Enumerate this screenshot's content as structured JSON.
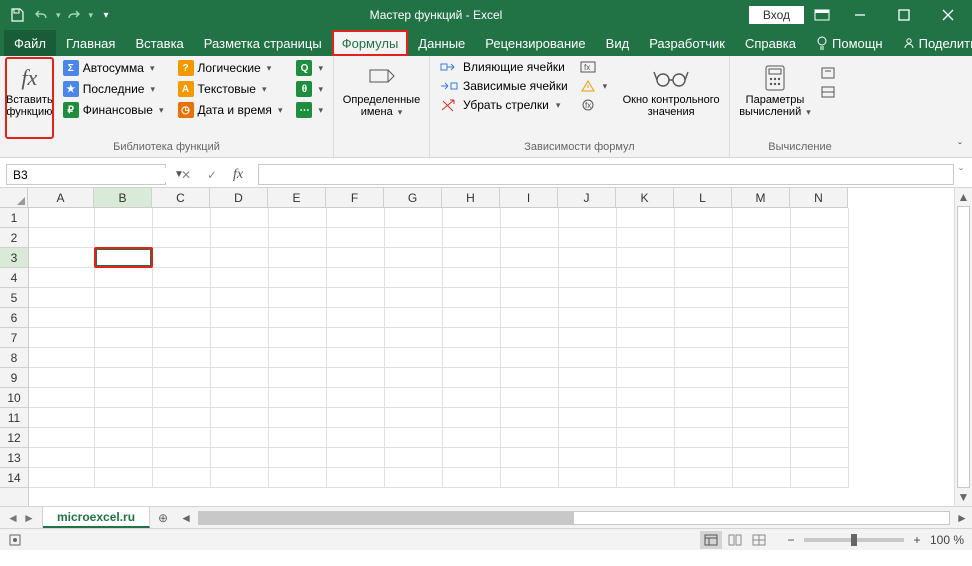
{
  "title": "Мастер функций  -  Excel",
  "signin": "Вход",
  "tabs": {
    "file": "Файл",
    "home": "Главная",
    "insert": "Вставка",
    "layout": "Разметка страницы",
    "formulas": "Формулы",
    "data": "Данные",
    "review": "Рецензирование",
    "view": "Вид",
    "developer": "Разработчик",
    "help": "Справка",
    "tellme": "Помощн",
    "share": "Поделиться"
  },
  "ribbon": {
    "insert_fn_l1": "Вставить",
    "insert_fn_l2": "функцию",
    "autosum": "Автосумма",
    "recent": "Последние",
    "financial": "Финансовые",
    "logical": "Логические",
    "text": "Текстовые",
    "datetime": "Дата и время",
    "group_library": "Библиотека функций",
    "defined_l1": "Определенные",
    "defined_l2": "имена",
    "trace_precedents": "Влияющие ячейки",
    "trace_dependents": "Зависимые ячейки",
    "remove_arrows": "Убрать стрелки",
    "watch_l1": "Окно контрольного",
    "watch_l2": "значения",
    "group_audit": "Зависимости формул",
    "calc_l1": "Параметры",
    "calc_l2": "вычислений",
    "group_calc": "Вычисление"
  },
  "namebox": "B3",
  "columns": [
    "A",
    "B",
    "C",
    "D",
    "E",
    "F",
    "G",
    "H",
    "I",
    "J",
    "K",
    "L",
    "M",
    "N"
  ],
  "rows": [
    "1",
    "2",
    "3",
    "4",
    "5",
    "6",
    "7",
    "8",
    "9",
    "10",
    "11",
    "12",
    "13",
    "14"
  ],
  "active_cell": {
    "col": "B",
    "row": "3"
  },
  "sheet": "microexcel.ru",
  "zoom": "100 %",
  "col_widths": {
    "A": 66,
    "default": 58
  }
}
